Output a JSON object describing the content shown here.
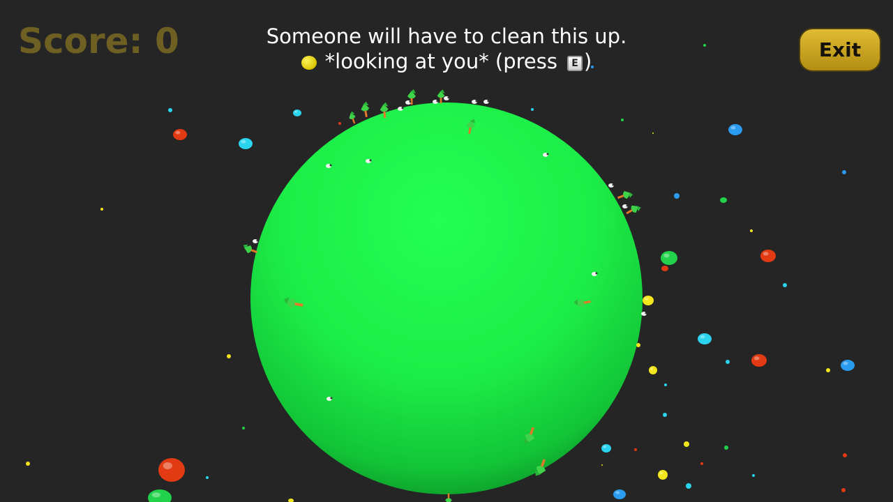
{
  "hud": {
    "score_label": "Score: 0",
    "message_line1": "Someone will have to clean this up.",
    "message_line2_text": "*looking at you* (press",
    "key_hint": "E",
    "message_line2_close": ")",
    "exit_label": "Exit"
  },
  "colors": {
    "background": "#252525",
    "planet": "#1ef04a",
    "score_text": "#6e5f22",
    "exit_button": "#d4ac27",
    "orb_red": "#e23a12",
    "orb_cyan": "#2ad4ee",
    "orb_blue": "#2a9cf0",
    "orb_yellow": "#f4e61c",
    "orb_green": "#22d24a"
  },
  "scene": {
    "planet": "planet",
    "objects": [
      "tree",
      "sheep",
      "orb"
    ]
  }
}
